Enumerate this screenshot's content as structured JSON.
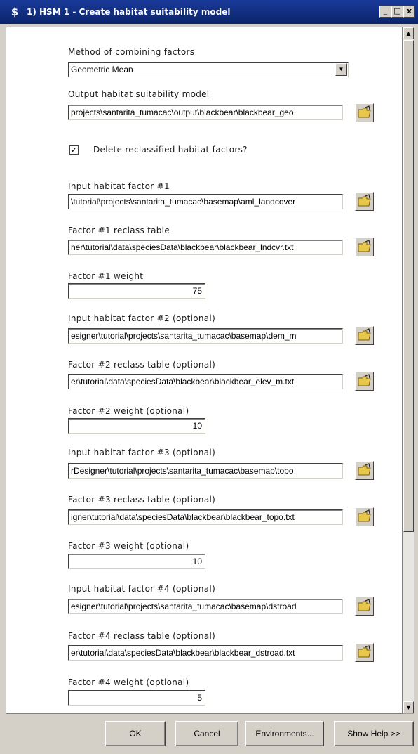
{
  "window": {
    "title": "1) HSM 1 - Create habitat suitability model",
    "app_icon": "$",
    "minimize": "_",
    "maximize": "□",
    "close": "x"
  },
  "method": {
    "label": "Method of combining factors",
    "value": "Geometric Mean"
  },
  "output": {
    "label": "Output habitat suitability model",
    "value": "projects\\santarita_tumacac\\output\\blackbear\\blackbear_geo"
  },
  "delete_check": {
    "label": "Delete reclassified habitat factors?",
    "checked": true,
    "mark": "✓"
  },
  "factors": [
    {
      "input_label": "Input habitat factor #1",
      "input_value": "\\tutorial\\projects\\santarita_tumacac\\basemap\\aml_landcover",
      "table_label": "Factor #1 reclass table",
      "table_value": "ner\\tutorial\\data\\speciesData\\blackbear\\blackbear_lndcvr.txt",
      "weight_label": "Factor #1 weight",
      "weight_value": "75"
    },
    {
      "input_label": "Input habitat factor #2 (optional)",
      "input_value": "esigner\\tutorial\\projects\\santarita_tumacac\\basemap\\dem_m",
      "table_label": "Factor #2 reclass table (optional)",
      "table_value": "er\\tutorial\\data\\speciesData\\blackbear\\blackbear_elev_m.txt",
      "weight_label": "Factor #2 weight (optional)",
      "weight_value": "10"
    },
    {
      "input_label": "Input habitat factor #3 (optional)",
      "input_value": "rDesigner\\tutorial\\projects\\santarita_tumacac\\basemap\\topo",
      "table_label": "Factor #3 reclass table (optional)",
      "table_value": "igner\\tutorial\\data\\speciesData\\blackbear\\blackbear_topo.txt",
      "weight_label": "Factor #3 weight (optional)",
      "weight_value": "10"
    },
    {
      "input_label": "Input habitat factor #4 (optional)",
      "input_value": "esigner\\tutorial\\projects\\santarita_tumacac\\basemap\\dstroad",
      "table_label": "Factor #4 reclass table (optional)",
      "table_value": "er\\tutorial\\data\\speciesData\\blackbear\\blackbear_dstroad.txt",
      "weight_label": "Factor #4 weight (optional)",
      "weight_value": "5"
    }
  ],
  "buttons": {
    "ok": "OK",
    "cancel": "Cancel",
    "environments": "Environments...",
    "help": "Show Help >>"
  },
  "scroll": {
    "up": "▲",
    "down": "▼",
    "dropdown": "▼"
  }
}
